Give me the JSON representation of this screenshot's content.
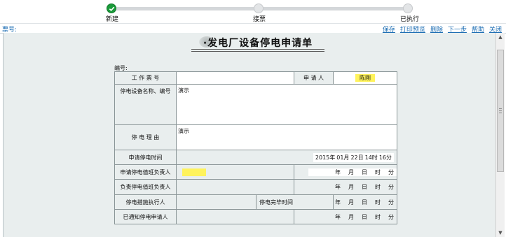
{
  "progress": {
    "steps": [
      {
        "label": "新建",
        "state": "done"
      },
      {
        "label": "接票",
        "state": "pending"
      },
      {
        "label": "已执行",
        "state": "pending"
      }
    ]
  },
  "toolbar": {
    "ticket_label": "票号:",
    "links": [
      "保存",
      "打印预览",
      "删除",
      "下一步",
      "帮助",
      "关闭"
    ]
  },
  "form": {
    "title": "·发电厂设备停电申请单",
    "number_label": "编号:",
    "ticket_no_label": "工 作 票 号",
    "ticket_no_value": "",
    "applicant_label": "申 请 人",
    "applicant_value": "陈刚",
    "equipment_label": "停电设备名称、编号",
    "equipment_value": "演示",
    "reason_label": "停 电 理 由",
    "reason_value": "演示",
    "request_time_label": "申请停电时间",
    "request_time": {
      "year": "2015年",
      "month": "01月",
      "day": "22日",
      "hour": "14时",
      "minute": "16分"
    },
    "shift_leader_request_label": "申请停电值班负责人",
    "shift_leader_label": "负责停电值班负责人",
    "executor_label": "停电措施执行人",
    "complete_time_label": "停电完毕时间",
    "notify_label": "已通知停电申请人",
    "date_units": {
      "year": "年",
      "month": "月",
      "day": "日",
      "hour": "时",
      "minute": "分"
    }
  },
  "colors": {
    "accent_link": "#1f6fb4",
    "highlight": "#fff35c",
    "done_step": "#1a9b3a",
    "page_bg": "#e9eeee"
  }
}
